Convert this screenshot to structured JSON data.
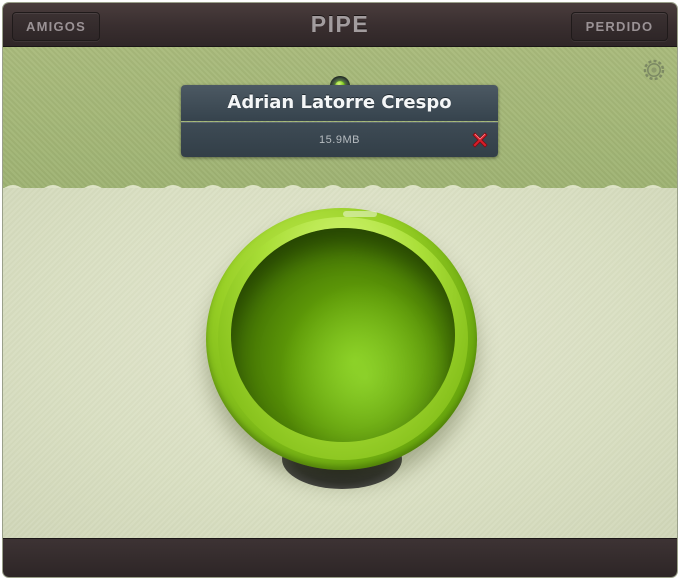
{
  "header": {
    "title": "PIPE",
    "left_button_label": "AMIGOS",
    "right_button_label": "PERDIDO"
  },
  "transfer": {
    "recipient_name": "Adrian Latorre Crespo",
    "file_size": "15.9MB",
    "status_color": "#7dcf1a"
  },
  "icons": {
    "settings": "gear-icon",
    "cancel": "close-icon",
    "status": "status-led-icon"
  },
  "colors": {
    "accent_green": "#98d026",
    "band_green": "#a9bb7c",
    "bar_dark": "#3a2f30",
    "cancel_red": "#d81e2a"
  }
}
